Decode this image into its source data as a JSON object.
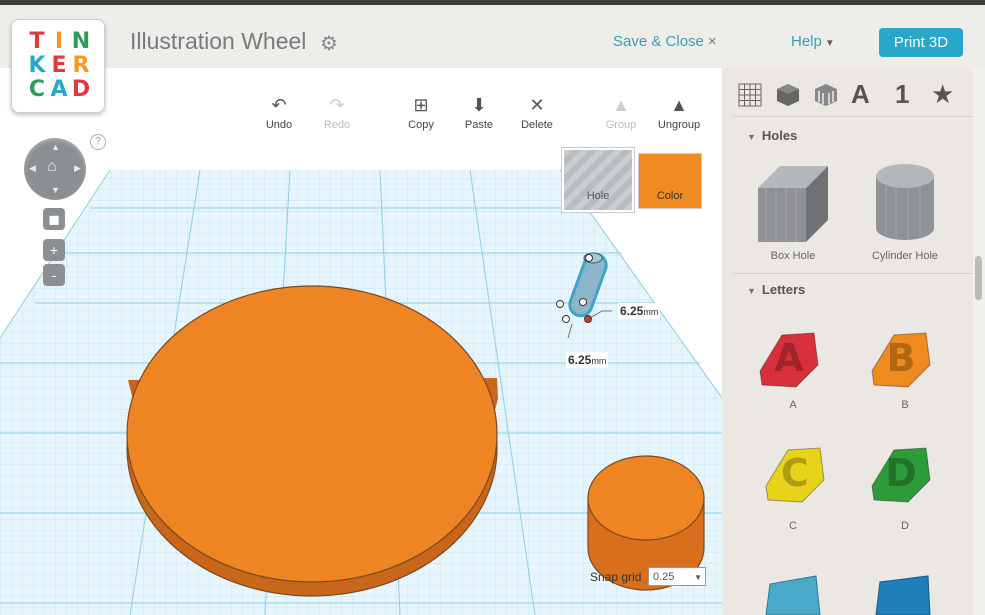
{
  "app": {
    "logo_letters": [
      "T",
      "I",
      "N",
      "K",
      "E",
      "R",
      "C",
      "A",
      "D"
    ],
    "logo_colors": [
      "#e03a3e",
      "#f39a1e",
      "#2a9e57",
      "#28a8c9",
      "#e03a3e",
      "#f39a1e",
      "#2a9e57",
      "#28a8c9",
      "#e03a3e"
    ]
  },
  "header": {
    "title": "Illustration Wheel",
    "settings_icon": "gear-icon",
    "save_close": "Save & Close",
    "close_glyph": "×",
    "help": "Help",
    "help_caret": "▼",
    "print": "Print 3D"
  },
  "toolbar": {
    "undo": "Undo",
    "redo": "Redo",
    "copy": "Copy",
    "paste": "Paste",
    "delete": "Delete",
    "group": "Group",
    "ungroup": "Ungroup"
  },
  "view": {
    "help": "?",
    "zoom_in": "+",
    "zoom_out": "-"
  },
  "inspector": {
    "hole": "Hole",
    "color": "Color",
    "color_value": "#f08a22"
  },
  "dimensions": {
    "width_value": "6.25",
    "width_unit": "mm",
    "depth_value": "6.25",
    "depth_unit": "mm"
  },
  "snap": {
    "label": "Snap grid",
    "value": "0.25"
  },
  "panel": {
    "sections": {
      "holes": "Holes",
      "letters": "Letters"
    },
    "holes": [
      {
        "label": "Box Hole"
      },
      {
        "label": "Cylinder Hole"
      }
    ],
    "letters": [
      {
        "label": "A",
        "color": "#d8303a"
      },
      {
        "label": "B",
        "color": "#ee8a1e"
      },
      {
        "label": "C",
        "color": "#e8d21a"
      },
      {
        "label": "D",
        "color": "#2f9a3a"
      }
    ],
    "tabs": [
      "A",
      "1",
      "★"
    ]
  }
}
